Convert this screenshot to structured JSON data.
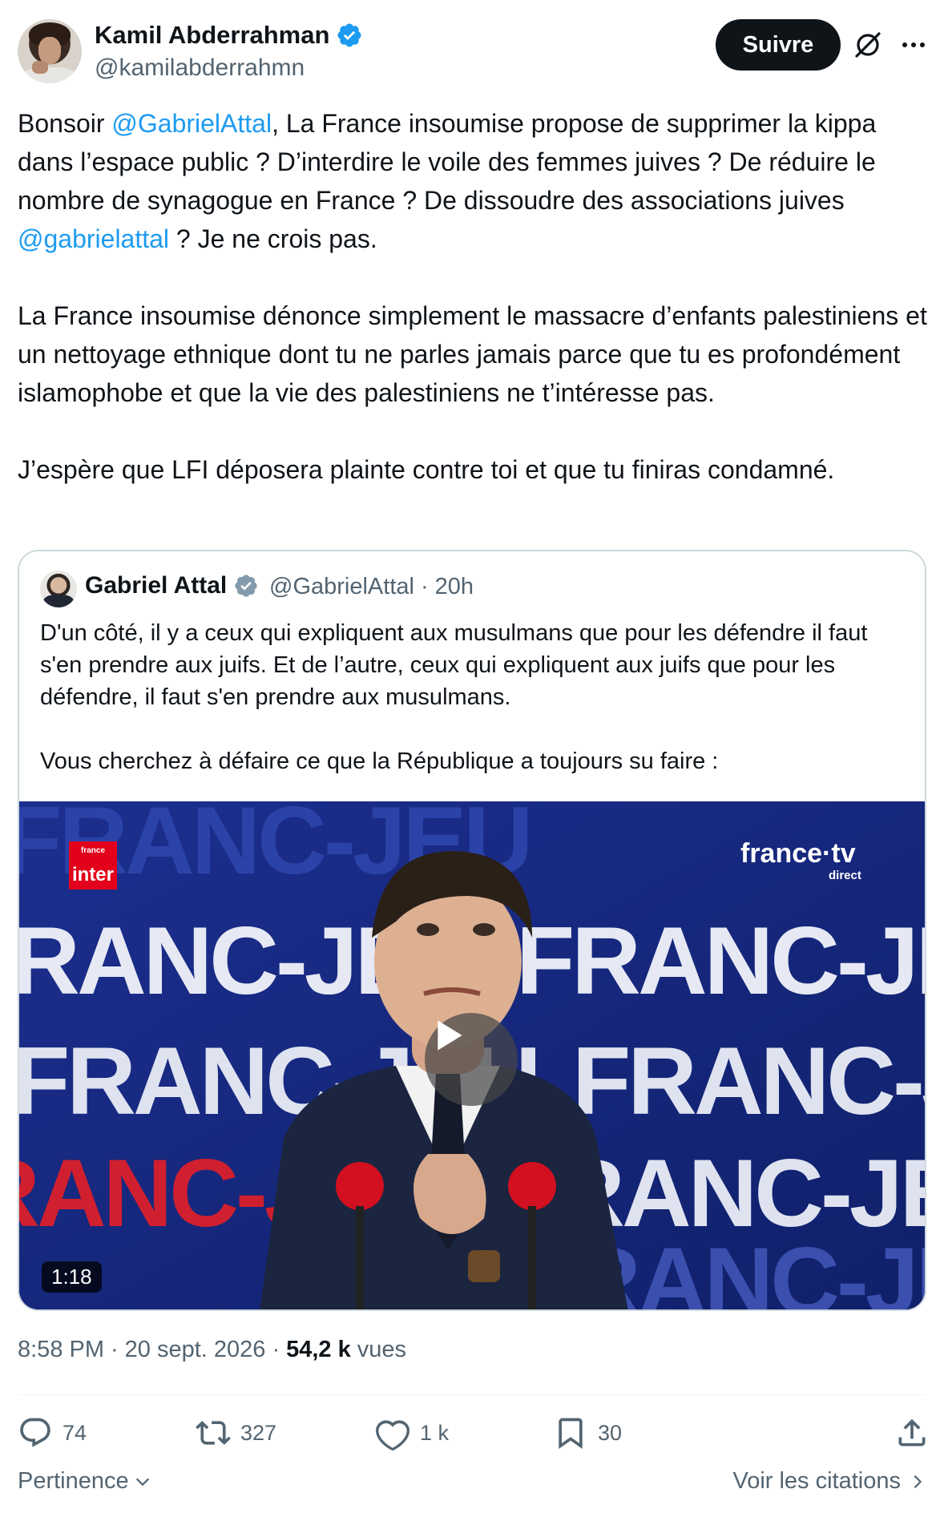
{
  "author": {
    "name": "Kamil Abderrahman",
    "handle": "@kamilabderrahmn"
  },
  "header": {
    "follow_label": "Suivre"
  },
  "tweet": {
    "p1_a": "Bonsoir ",
    "p1_mention": "@GabrielAttal",
    "p1_b": ", La France insoumise propose de supprimer la kippa dans l’espace public ? D’interdire le voile des femmes juives ? De réduire le nombre de synagogue en France ? De dissoudre des associations juives ",
    "p1_mention2": "@gabrielattal",
    "p1_c": " ? Je ne crois pas.",
    "p2": "La France insoumise dénonce simplement le massacre d’enfants palestiniens et un nettoyage ethnique dont tu ne parles jamais parce que tu es profondément islamophobe et que la vie des palestiniens ne t’intéresse pas.",
    "p3": "J’espère que LFI déposera plainte contre toi et que tu finiras condamné."
  },
  "quote": {
    "name": "Gabriel Attal",
    "handle": "@GabrielAttal",
    "separator": "·",
    "time": "20h",
    "p1": "D'un côté, il y a ceux qui expliquent aux musulmans que pour les défendre il faut s'en prendre aux juifs. Et de l’autre, ceux qui expliquent aux juifs que pour les défendre, il faut s'en prendre aux musulmans.",
    "p2": "Vous cherchez à défaire ce que la République a toujours su faire :",
    "video": {
      "duration": "1:18",
      "logo_left_small": "france",
      "logo_left": "inter",
      "logo_right": "france·tv",
      "logo_right_sub": "direct",
      "backdrop_text": "FRANC-JEU"
    }
  },
  "meta": {
    "time": "8:58 PM",
    "sep1": "·",
    "date": "20 sept. 2026",
    "sep2": "·",
    "views_count": "54,2 k",
    "views_label": "vues"
  },
  "actions": {
    "replies": "74",
    "reposts": "327",
    "likes": "1 k",
    "bookmarks": "30"
  },
  "footer": {
    "sort_label": "Pertinence",
    "quotes_link": "Voir les citations"
  },
  "colors": {
    "accent": "#1d9bf0",
    "text": "#0f1419",
    "secondary": "#536471",
    "border": "#cfd9de"
  }
}
